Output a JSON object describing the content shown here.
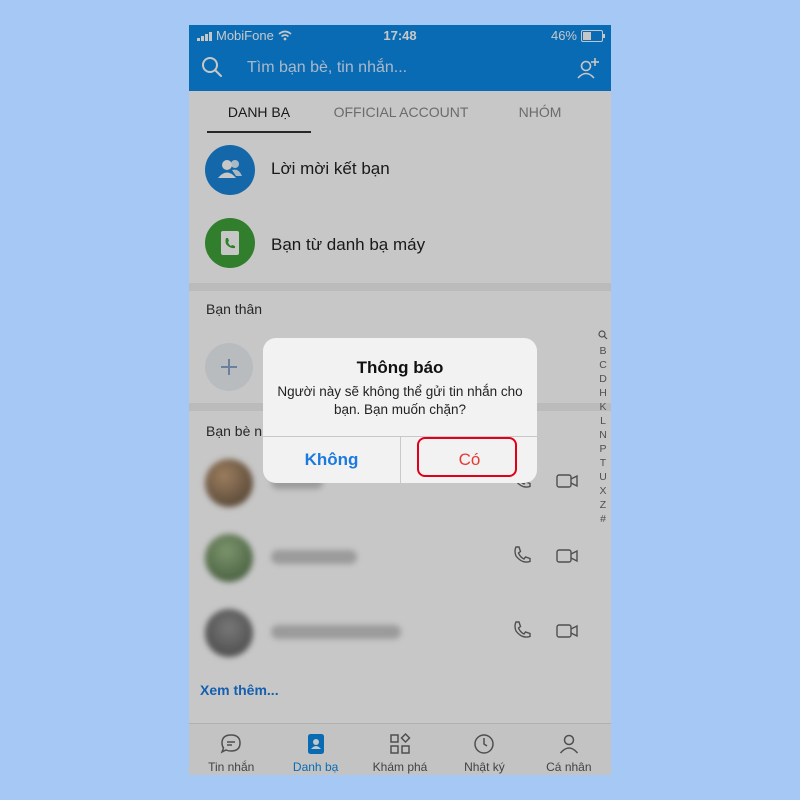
{
  "status_bar": {
    "carrier": "MobiFone",
    "time": "17:48",
    "battery": "46%",
    "battery_level": 0.46
  },
  "header": {
    "search_placeholder": "Tìm bạn bè, tin nhắn..."
  },
  "tabs": [
    {
      "label": "DANH BẠ",
      "active": true
    },
    {
      "label": "OFFICIAL ACCOUNT",
      "active": false
    },
    {
      "label": "NHÓM",
      "active": false
    }
  ],
  "quick_rows": [
    {
      "label": "Lời mời kết bạn",
      "icon": "friends-icon",
      "color": "#1a86d9"
    },
    {
      "label": "Bạn từ danh bạ máy",
      "icon": "phonebook-icon",
      "color": "#3fa23a"
    }
  ],
  "sections": {
    "close_friends": "Bạn thân",
    "recent_friends": "Bạn bè n"
  },
  "see_more": "Xem thêm...",
  "alphabet": [
    "Q",
    "B",
    "C",
    "D",
    "H",
    "K",
    "L",
    "N",
    "P",
    "T",
    "U",
    "X",
    "Z",
    "#"
  ],
  "bottom_nav": [
    {
      "label": "Tin nhắn",
      "icon": "chat-icon",
      "active": false
    },
    {
      "label": "Danh bạ",
      "icon": "contacts-icon",
      "active": true
    },
    {
      "label": "Khám phá",
      "icon": "discover-icon",
      "active": false
    },
    {
      "label": "Nhật ký",
      "icon": "clock-icon",
      "active": false
    },
    {
      "label": "Cá nhân",
      "icon": "profile-icon",
      "active": false
    }
  ],
  "dialog": {
    "title": "Thông báo",
    "message": "Người này sẽ không thể gửi tin nhắn cho bạn. Bạn muốn chặn?",
    "cancel_label": "Không",
    "confirm_label": "Có"
  },
  "colors": {
    "brand": "#0d8ae8",
    "danger": "#e53935",
    "background": "#a6c8f5"
  }
}
